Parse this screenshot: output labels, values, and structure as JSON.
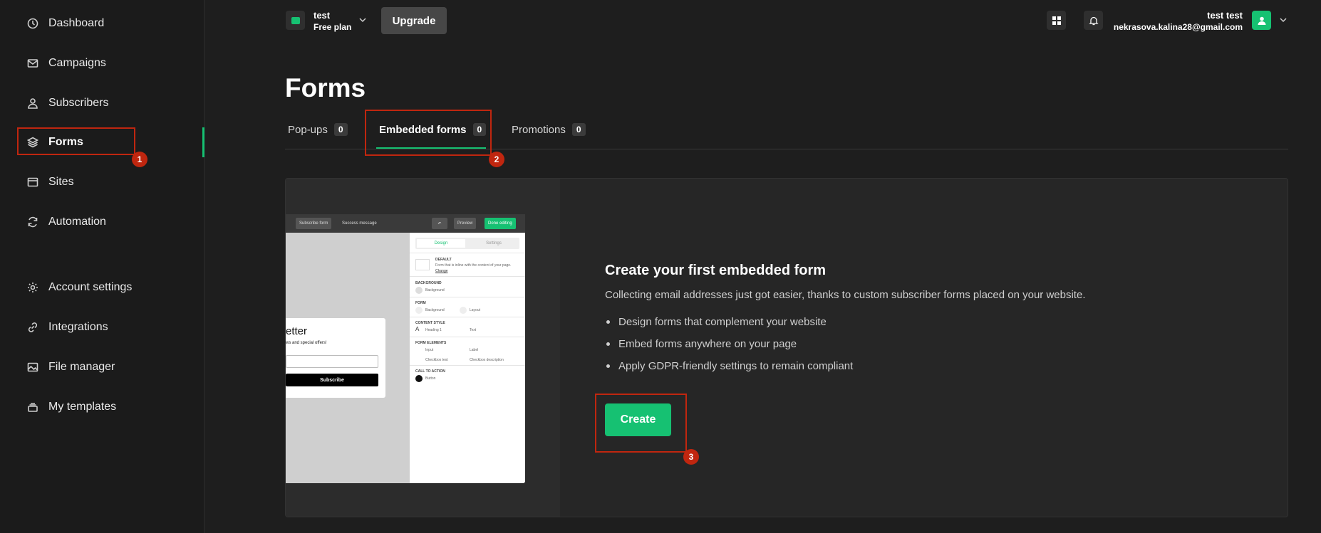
{
  "sidebar": {
    "items": [
      {
        "label": "Dashboard",
        "icon": "dashboard-icon"
      },
      {
        "label": "Campaigns",
        "icon": "mail-icon"
      },
      {
        "label": "Subscribers",
        "icon": "user-icon"
      },
      {
        "label": "Forms",
        "icon": "layers-icon"
      },
      {
        "label": "Sites",
        "icon": "browser-icon"
      },
      {
        "label": "Automation",
        "icon": "refresh-icon"
      },
      {
        "label": "Account settings",
        "icon": "gear-icon"
      },
      {
        "label": "Integrations",
        "icon": "link-icon"
      },
      {
        "label": "File manager",
        "icon": "image-icon"
      },
      {
        "label": "My templates",
        "icon": "stack-icon"
      }
    ],
    "active_index": 3
  },
  "header": {
    "workspace_name": "test",
    "workspace_plan": "Free plan",
    "upgrade_label": "Upgrade",
    "user_name": "test test",
    "user_email": "nekrasova.kalina28@gmail.com"
  },
  "page": {
    "title": "Forms",
    "tabs": [
      {
        "label": "Pop-ups",
        "count": "0"
      },
      {
        "label": "Embedded forms",
        "count": "0"
      },
      {
        "label": "Promotions",
        "count": "0"
      }
    ]
  },
  "card": {
    "title": "Create your first embedded form",
    "description": "Collecting email addresses just got easier, thanks to custom subscriber forms placed on your website.",
    "bullets": [
      "Design forms that complement your website",
      "Embed forms anywhere on your page",
      "Apply GDPR-friendly settings to remain compliant"
    ],
    "create_label": "Create"
  },
  "preview": {
    "subscribe_form": "Subscribe form",
    "success_message": "Success message",
    "preview_btn": "Preview",
    "done_btn": "Done editing",
    "design_tab": "Design",
    "settings_tab": "Settings",
    "default_label": "DEFAULT",
    "default_desc": "Form that is inline with the content of your page.",
    "change_link": "Change",
    "background_section": "BACKGROUND",
    "background_item": "Background",
    "form_section": "FORM",
    "form_background": "Background",
    "form_layout": "Layout",
    "content_style_section": "CONTENT STYLE",
    "heading_item": "Heading 1",
    "text_item": "Text",
    "form_elements_section": "FORM ELEMENTS",
    "input_item": "Input",
    "label_item": "Label",
    "checkbox_text_item": "Checkbox text",
    "checkbox_desc_item": "Checkbox description",
    "cta_section": "CALL TO ACTION",
    "button_item": "Button",
    "form_title_fragment": "etter",
    "form_sub_fragment": "ws and special offers!",
    "subscribe_label": "Subscribe"
  },
  "annotations": [
    "1",
    "2",
    "3"
  ],
  "colors": {
    "accent": "#16c172",
    "annotation": "#c0260f",
    "background": "#1e1e1e"
  }
}
